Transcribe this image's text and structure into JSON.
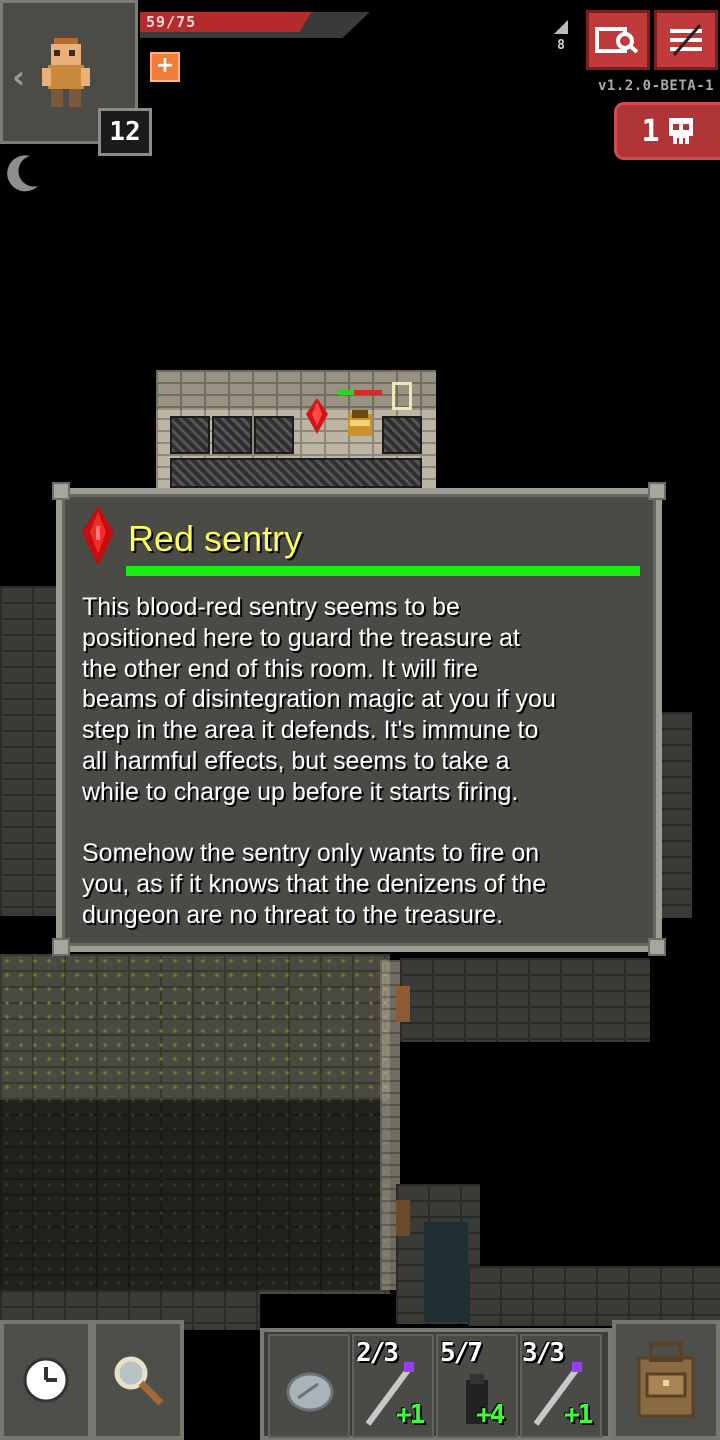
{
  "hud": {
    "hp_text": "59/75",
    "hp_fraction": 0.787,
    "hero_level": "12",
    "depth": "8",
    "version": "v1.2.0-BETA-1",
    "danger_count": "1",
    "buff_icon": "plus-icon",
    "journal_icon": "journal-search-icon",
    "menu_icon": "menu-icon",
    "skull_icon": "skull-icon"
  },
  "info": {
    "title": "Red sentry",
    "health_fraction": 1.0,
    "paragraph_1_lines": [
      "This blood-red sentry seems to be",
      "positioned here to guard the treasure at",
      "the other end of this room. It will fire",
      "beams of disintegration magic at you if you",
      "step in the area it defends. It's immune to",
      "all harmful effects, but seems to take a",
      "while to charge up before it starts firing."
    ],
    "paragraph_2_lines": [
      "Somehow the sentry only wants to fire on",
      "you, as if it knows that the denizens of the",
      "dungeon are no threat to the treasure."
    ]
  },
  "toolbar": {
    "wait_icon": "clock-icon",
    "search_icon": "magnifier-icon",
    "throw_icon": "stone-icon",
    "backpack_icon": "backpack-icon",
    "quickslots": [
      {
        "icon": "wand-icon",
        "charges": "2/3",
        "upgrade": "+1"
      },
      {
        "icon": "wand-icon",
        "charges": "5/7",
        "upgrade": "+4"
      },
      {
        "icon": "wand-icon",
        "charges": "3/3",
        "upgrade": "+1"
      }
    ]
  },
  "colors": {
    "title": "#ffff54",
    "health": "#18f011",
    "hp": "#b52a2a",
    "button_red": "#c0393b"
  }
}
